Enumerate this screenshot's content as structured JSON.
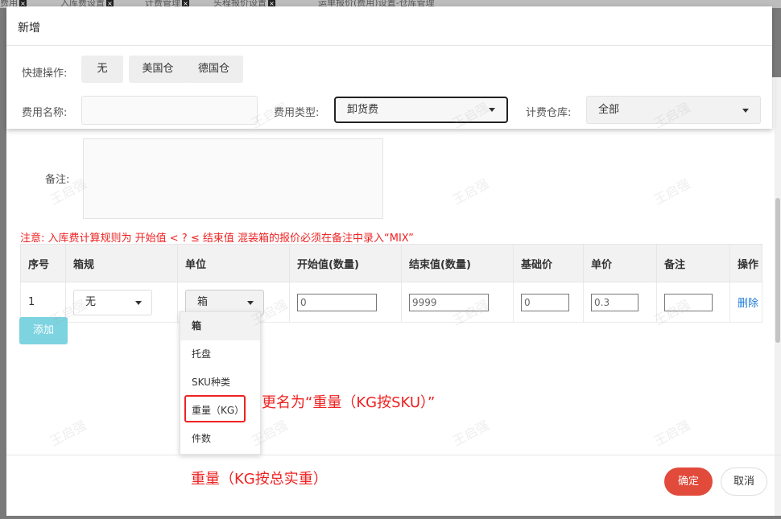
{
  "background_tabs": [
    "费用",
    "入库费设置",
    "计费管理",
    "头程报价设置",
    "运单报价(费用)设置-仓库管理"
  ],
  "dialog": {
    "title": "新增"
  },
  "quick": {
    "label": "快捷操作:",
    "buttons": [
      "无",
      "美国仓",
      "德国仓"
    ]
  },
  "fields": {
    "fee_name_label": "费用名称:",
    "fee_name_value": "",
    "fee_type_label": "费用类型:",
    "fee_type_value": "卸货费",
    "warehouse_label": "计费仓库:",
    "warehouse_value": "全部",
    "remark_label": "备注:",
    "remark_value": ""
  },
  "note": "注意:  入库费计算规则为 开始值 < ? ≤ 结束值   混装箱的报价必须在备注中录入“MIX”",
  "table": {
    "headers": [
      "序号",
      "箱规",
      "单位",
      "开始值(数量)",
      "结束值(数量)",
      "基础价",
      "单价",
      "备注",
      "操作"
    ],
    "rows": [
      {
        "index": "1",
        "box": "无",
        "unit": "箱",
        "start": "0",
        "end": "9999",
        "base": "0",
        "price": "0.3",
        "remark": "",
        "action": "删除"
      }
    ]
  },
  "add_button": "添加",
  "unit_dropdown": [
    "箱",
    "托盘",
    "SKU种类",
    "重量（KG）",
    "件数"
  ],
  "annotations": {
    "rename": "更名为“重量（KG按SKU）”",
    "total": "重量（KG按总实重）"
  },
  "footer": {
    "ok": "确定",
    "cancel": "取消"
  },
  "watermark": "王启强",
  "colors": {
    "accent": "#e24a3b",
    "annotation": "#e22222",
    "add": "#7dd3e0",
    "link": "#1e7bd8"
  }
}
